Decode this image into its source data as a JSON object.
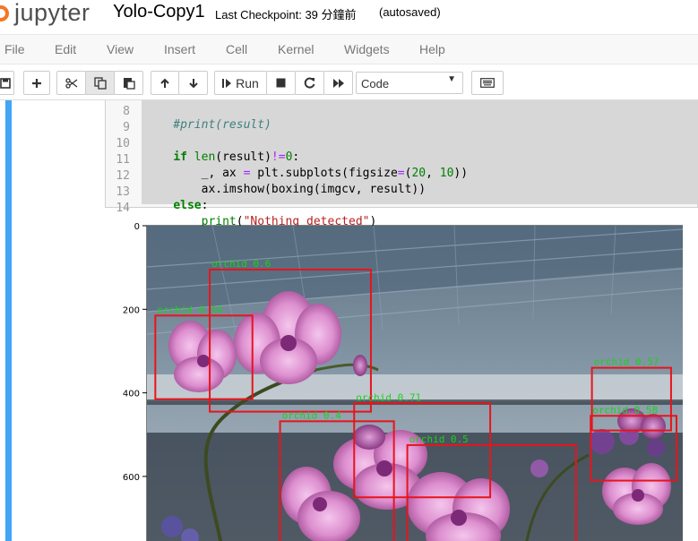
{
  "header": {
    "logo_text": "jupyter",
    "notebook_name": "Yolo-Copy1",
    "checkpoint": "Last Checkpoint: 39 分鐘前",
    "autosave": "(autosaved)"
  },
  "menu": [
    "File",
    "Edit",
    "View",
    "Insert",
    "Cell",
    "Kernel",
    "Widgets",
    "Help"
  ],
  "toolbar": {
    "run_label": "Run",
    "cell_type": "Code",
    "icons": [
      "save-icon",
      "plus-icon",
      "cut-icon",
      "copy-icon",
      "paste-icon",
      "arrow-up-icon",
      "arrow-down-icon",
      "step-forward-icon",
      "stop-icon",
      "restart-icon",
      "fast-forward-icon",
      "keyboard-icon"
    ]
  },
  "code_cell": {
    "lines": [
      {
        "n": "8",
        "text": "    #print(result)"
      },
      {
        "n": "9",
        "text": ""
      },
      {
        "n": "10",
        "text": "    if len(result)!=0:"
      },
      {
        "n": "11",
        "text": "        _, ax = plt.subplots(figsize=(20, 10))"
      },
      {
        "n": "12",
        "text": "        ax.imshow(boxing(imgcv, result))"
      },
      {
        "n": "13",
        "text": "    else:"
      },
      {
        "n": "14",
        "text": "        print(\"Nothing detected\")"
      }
    ]
  },
  "output": {
    "y_ticks": [
      "0",
      "200",
      "400",
      "600"
    ],
    "y_tick_values": [
      0,
      200,
      400,
      600
    ],
    "detections": [
      {
        "label": "orchid 0.6",
        "x0": 150,
        "y0": 105,
        "x1": 535,
        "y1": 445
      },
      {
        "label": "orchid 0.54",
        "x0": 20,
        "y0": 215,
        "x1": 252,
        "y1": 415
      },
      {
        "label": "orchid 0.71",
        "x0": 495,
        "y0": 425,
        "x1": 820,
        "y1": 650
      },
      {
        "label": "orchid 0.4",
        "x0": 318,
        "y0": 468,
        "x1": 590,
        "y1": 760
      },
      {
        "label": "orchid 0.5",
        "x0": 622,
        "y0": 525,
        "x1": 1025,
        "y1": 760
      },
      {
        "label": "orchid 0.57",
        "x0": 1063,
        "y0": 340,
        "x1": 1252,
        "y1": 490
      },
      {
        "label": "orchid 0.58",
        "x0": 1060,
        "y0": 455,
        "x1": 1265,
        "y1": 610
      }
    ],
    "box_color": "#e8141c",
    "label_color": "#1cd01c"
  }
}
